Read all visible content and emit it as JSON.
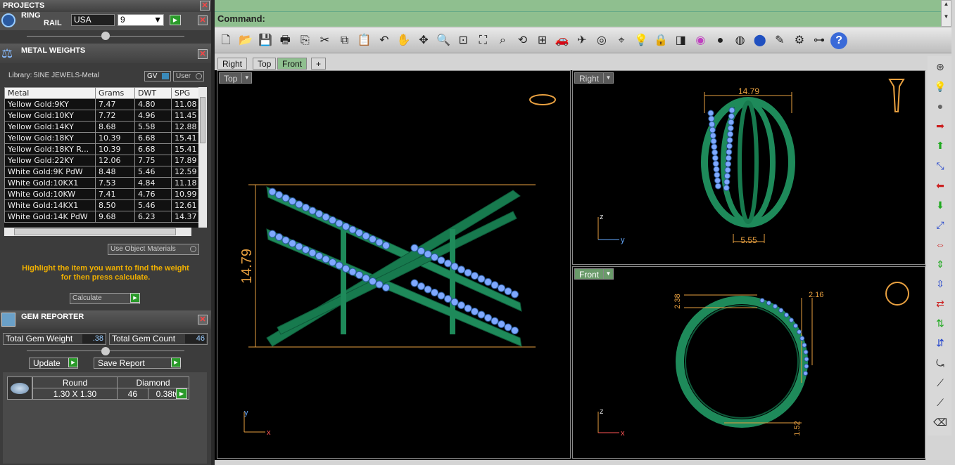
{
  "projects": {
    "title": "PROJECTS",
    "ring_rail_line1": "RING",
    "ring_rail_line2": "RAIL",
    "country": "USA",
    "size": "9"
  },
  "metal": {
    "title": "METAL WEIGHTS",
    "library": "Library: 5INE JEWELS-Metal",
    "gv": "GV",
    "user": "User",
    "headers": [
      "Metal",
      "Grams",
      "DWT",
      "SPG"
    ],
    "rows": [
      [
        "Yellow Gold:9KY",
        "7.47",
        "4.80",
        "11.08"
      ],
      [
        "Yellow Gold:10KY",
        "7.72",
        "4.96",
        "11.45"
      ],
      [
        "Yellow Gold:14KY",
        "8.68",
        "5.58",
        "12.88"
      ],
      [
        "Yellow Gold:18KY",
        "10.39",
        "6.68",
        "15.41"
      ],
      [
        "Yellow Gold:18KY R...",
        "10.39",
        "6.68",
        "15.41"
      ],
      [
        "Yellow Gold:22KY",
        "12.06",
        "7.75",
        "17.89"
      ],
      [
        "White Gold:9K PdW",
        "8.48",
        "5.46",
        "12.59"
      ],
      [
        "White Gold:10KX1",
        "7.53",
        "4.84",
        "11.18"
      ],
      [
        "White Gold:10KW",
        "7.41",
        "4.76",
        "10.99"
      ],
      [
        "White Gold:14KX1",
        "8.50",
        "5.46",
        "12.61"
      ],
      [
        "White Gold:14K PdW",
        "9.68",
        "6.23",
        "14.37"
      ]
    ],
    "use_object_materials": "Use Object Materials",
    "hint_line1": "Highlight the item you want to find the weight",
    "hint_line2": "for then press calculate.",
    "calculate": "Calculate"
  },
  "gem": {
    "title": "GEM REPORTER",
    "total_weight_label": "Total Gem Weight",
    "total_weight": ".38",
    "total_count_label": "Total Gem Count",
    "total_count": "46",
    "update": "Update",
    "save_report": "Save Report",
    "shape": "Round",
    "type": "Diamond",
    "size": "1.30 X 1.30",
    "count": "46",
    "tw": "0.38tw"
  },
  "command": {
    "label": "Command:"
  },
  "tabs": [
    "Right",
    "Top",
    "Front",
    "+"
  ],
  "viewports": {
    "top": "Top",
    "right": "Right",
    "front": "Front"
  },
  "dimensions": {
    "top_height": "14.79",
    "right_width": "14.79",
    "right_base": "5.55",
    "front_a": "2.38",
    "front_b": "2.16",
    "front_c": "1.52"
  },
  "axes": {
    "z": "z",
    "y": "y",
    "x": "x"
  },
  "colors": {
    "ring": "#1e8a5a",
    "gem": "#7fa8ff",
    "dim": "#e8a040",
    "panel_bg": "#3c3c3c"
  }
}
